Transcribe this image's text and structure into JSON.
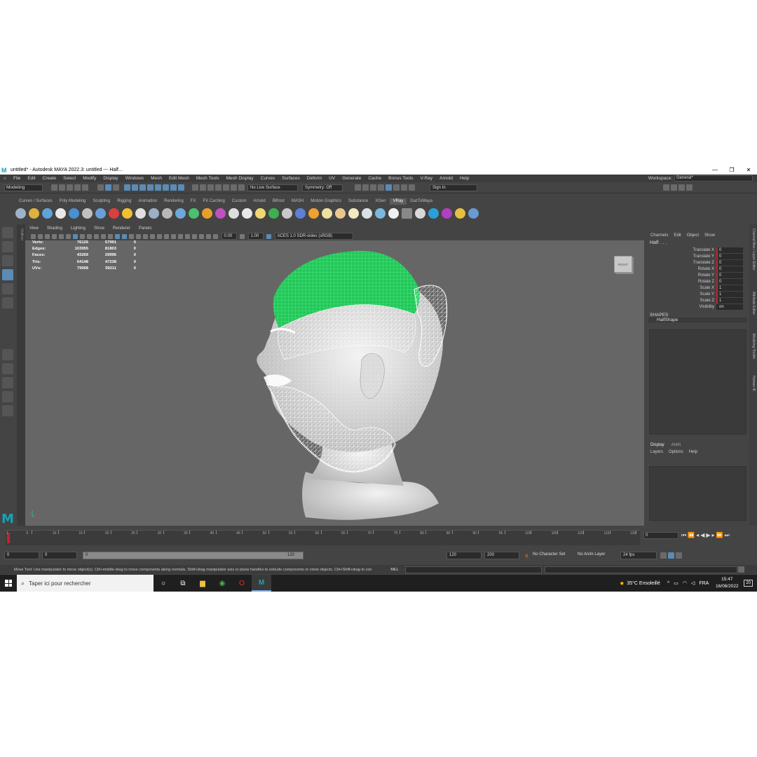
{
  "window": {
    "title": "untitled* - Autodesk MAYA 2022.3: untitled  ---  Half..."
  },
  "menubar": {
    "items": [
      "File",
      "Edit",
      "Create",
      "Select",
      "Modify",
      "Display",
      "Windows",
      "Mesh",
      "Edit Mesh",
      "Mesh Tools",
      "Mesh Display",
      "Curves",
      "Surfaces",
      "Deform",
      "UV",
      "Generate",
      "Cache",
      "Bonus Tools",
      "V-Ray",
      "Arnold",
      "Help"
    ],
    "workspace_label": "Workspace:",
    "workspace_value": "General*"
  },
  "statusline": {
    "mode": "Modeling",
    "live_surface": "No Live Surface",
    "symmetry": "Symmetry: Off",
    "sign_in": "Sign In"
  },
  "shelf": {
    "tabs": [
      "Curves / Surfaces",
      "Poly Modeling",
      "Sculpting",
      "Rigging",
      "Animation",
      "Rendering",
      "FX",
      "FX Caching",
      "Custom",
      "Arnold",
      "Bifrost",
      "MASH",
      "Motion Graphics",
      "Substance",
      "XGen",
      "VRay",
      "DazToMaya"
    ],
    "active_tab": "VRay"
  },
  "outliner_label": "Outliner",
  "panel": {
    "menus": [
      "View",
      "Shading",
      "Lighting",
      "Show",
      "Renderer",
      "Panels"
    ],
    "exposure": "0.00",
    "gamma": "1.00",
    "color_space": "ACES 1.0 SDR-video (sRGB)"
  },
  "hud": {
    "rows": [
      {
        "label": "Verts:",
        "a": "76126",
        "b": "57991",
        "c": "0"
      },
      {
        "label": "Edges:",
        "a": "103955",
        "b": "81803",
        "c": "0"
      },
      {
        "label": "Faces:",
        "a": "43269",
        "b": "29996",
        "c": "0"
      },
      {
        "label": "Tris:",
        "a": "64148",
        "b": "47238",
        "c": "0"
      },
      {
        "label": "UVs:",
        "a": "79068",
        "b": "59211",
        "c": "0"
      }
    ]
  },
  "viewcube_label": "RIGHT",
  "channel_box": {
    "tabs": [
      "Channels",
      "Edit",
      "Object",
      "Show"
    ],
    "object_name": "Half . . .",
    "attributes": [
      {
        "name": "Translate X",
        "value": "0"
      },
      {
        "name": "Translate Y",
        "value": "0"
      },
      {
        "name": "Translate Z",
        "value": "0"
      },
      {
        "name": "Rotate X",
        "value": "0"
      },
      {
        "name": "Rotate Y",
        "value": "0"
      },
      {
        "name": "Rotate Z",
        "value": "0"
      },
      {
        "name": "Scale X",
        "value": "1"
      },
      {
        "name": "Scale Y",
        "value": "1"
      },
      {
        "name": "Scale Z",
        "value": "1"
      },
      {
        "name": "Visibility",
        "value": "on"
      }
    ],
    "shapes_header": "SHAPES",
    "shape_name": "HalfShape"
  },
  "side_tabs": [
    "Channel Box / Layer Editor",
    "Attribute Editor",
    "Modeling Toolkit",
    "Human IK"
  ],
  "layer_editor": {
    "tabs": [
      "Display",
      "Anim"
    ],
    "active_tab": "Display",
    "menus": [
      "Layers",
      "Options",
      "Help"
    ]
  },
  "timeslider": {
    "ticks": [
      "5",
      "10",
      "15",
      "20",
      "25",
      "30",
      "35",
      "40",
      "45",
      "50",
      "55",
      "60",
      "65",
      "70",
      "75",
      "80",
      "85",
      "90",
      "95",
      "100",
      "105",
      "110",
      "115",
      "120"
    ],
    "start_tick": "1",
    "current_frame": "0"
  },
  "rangeslider": {
    "start": "0",
    "playback_start": "0",
    "range_left": "0",
    "range_right": "120",
    "playback_end": "120",
    "end": "200",
    "character_set": "No Character Set",
    "anim_layer": "No Anim Layer",
    "fps": "24 fps"
  },
  "helpline": {
    "text": "Move Tool: Use manipulator to move object(s). Ctrl+middle-drag to move components along normals. Shift+drag manipulator axis or plane handles to extrude components or clone objects. Ctrl+Shift+drag to con",
    "mel": "MEL"
  },
  "taskbar": {
    "search_placeholder": "Taper ici pour rechercher",
    "weather": "35°C  Ensoleillé",
    "lang": "FRA",
    "time": "15:47",
    "date": "16/06/2022",
    "notif_count": "20"
  },
  "colors": {
    "accent": "#5a8bb5",
    "keyed": "#c8202a",
    "selection_wire": "#2ee06a"
  }
}
